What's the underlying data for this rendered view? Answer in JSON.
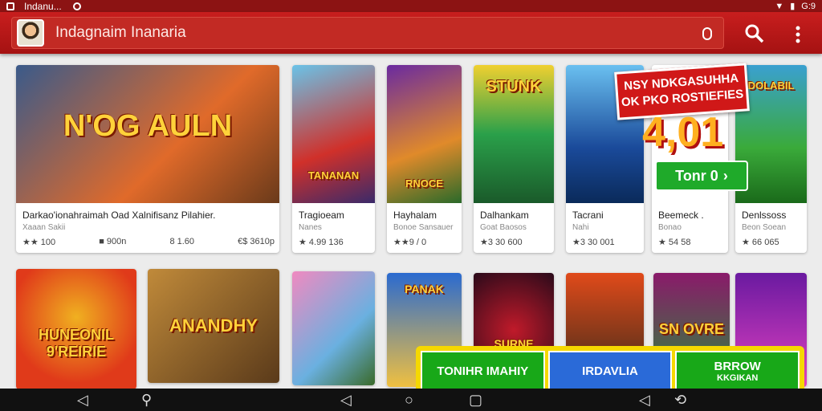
{
  "status_bar": {
    "app_name": "Indanu...",
    "right_text": "G:9"
  },
  "search": {
    "value": "Indagnaim Inanaria"
  },
  "row1": [
    {
      "art_text": "N'OG AULN",
      "title": "Darkao'ionahraimah Oad Xalnifisanz Pilahier.",
      "sub": "Xaaan Sakii",
      "stats": [
        "★★ 100",
        "■ 900n",
        "8 1.60",
        "€$ 3610p"
      ],
      "colors": [
        "#3a5a8a",
        "#e06a2a"
      ]
    },
    {
      "art_text": "TANANAN",
      "title": "Tragioeam",
      "sub": "Nanes",
      "stats": [
        "★ 4.99 136"
      ],
      "colors": [
        "#6ac3e8",
        "#d0302a"
      ]
    },
    {
      "art_text": "RNOCE",
      "title": "Hayhalam",
      "sub": "Bonoe Sansauer",
      "stats": [
        "★★9 / 0"
      ],
      "colors": [
        "#6a2aa0",
        "#e08a2a"
      ]
    },
    {
      "art_text": "STUNK",
      "title": "Dalhankam",
      "sub": "Goat Baosos",
      "stats": [
        "★3 30 600"
      ],
      "colors": [
        "#2aa04a",
        "#f0d030"
      ]
    },
    {
      "art_text": "",
      "title": "Tacrani",
      "sub": "Nahi",
      "stats": [
        "★3 30 001"
      ],
      "colors": [
        "#1a4a9a",
        "#6ac0f0"
      ]
    },
    {
      "art_text": "",
      "title": "Beemeck .",
      "sub": "Bonao",
      "stats": [
        "★ 54 58"
      ],
      "colors": [
        "#3aa0d0",
        "#2a9a2a"
      ]
    },
    {
      "art_text": "DOLABIL",
      "title": "Denlssoss",
      "sub": "Beon Soean",
      "stats": [
        "★ 66 065"
      ],
      "colors": [
        "#2a7ad0",
        "#3aaa3a"
      ]
    }
  ],
  "promo": {
    "headline": "NSY NDKGASUHHA OK PKO ROSTIEFIES",
    "price": "4,01",
    "button_label": "Tonr 0"
  },
  "row2": [
    {
      "art_text": "HUNEONIL 9'REIRIE",
      "colors": [
        "#e03a1a",
        "#f0b020"
      ]
    },
    {
      "art_text": "ANANDHY",
      "colors": [
        "#5a3a1a",
        "#c08a3a"
      ]
    },
    {
      "art_text": "",
      "colors": [
        "#f08ac0",
        "#6ab0e0"
      ]
    },
    {
      "art_text": "PANAK",
      "colors": [
        "#2a6ad0",
        "#f0c040"
      ]
    },
    {
      "art_text": "SURNE",
      "colors": [
        "#c01a2a",
        "#2a0a1a"
      ]
    },
    {
      "art_text": "",
      "colors": [
        "#e04a1a",
        "#3a2a1a"
      ]
    },
    {
      "art_text": "SN OVRE",
      "colors": [
        "#8a1a6a",
        "#2a8a3a"
      ]
    },
    {
      "art_text": "",
      "colors": [
        "#6a1aa0",
        "#e040c0"
      ]
    }
  ],
  "bottom_bar": {
    "btn1": "TONIHR IMAHIY",
    "btn2": "IRDAVLIA",
    "btn3_line1": "BRROW",
    "btn3_line2": "KKGIKAN",
    "colors": [
      "#18a818",
      "#2a6ad8",
      "#18a818"
    ]
  },
  "icons": [
    "search-icon",
    "more-vert-icon",
    "mic-icon",
    "back-icon",
    "home-icon",
    "recents-icon"
  ]
}
